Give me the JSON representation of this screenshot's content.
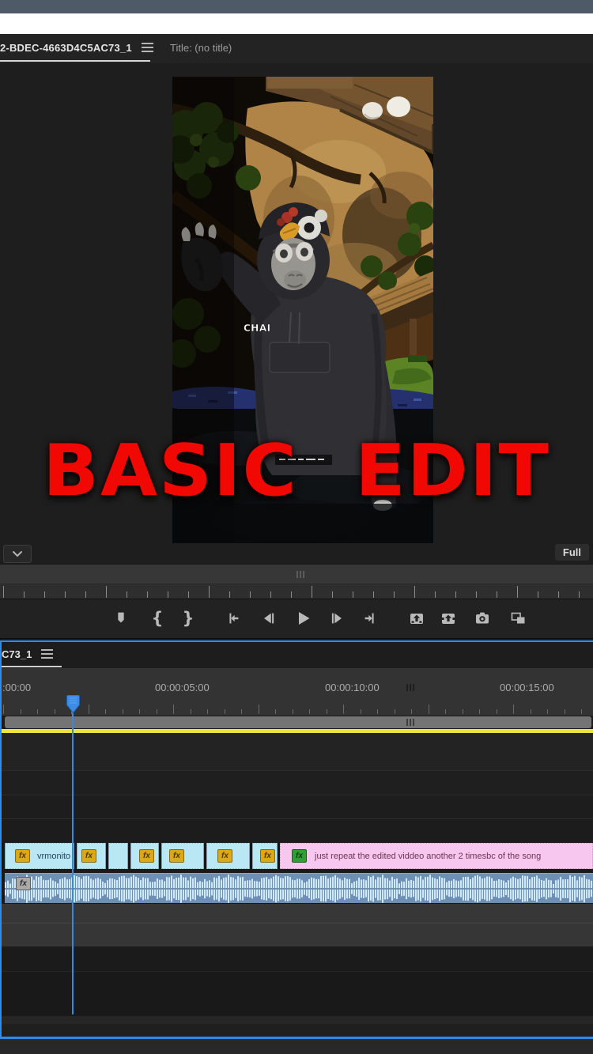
{
  "program_monitor": {
    "tab_label": "2-BDEC-4663D4C5AC73_1",
    "title_label": "Title: (no title)",
    "overlay_text": "BASIC EDIT",
    "player_name": "CHAI",
    "playback_resolution": "Full",
    "mark_in_glyph": "{",
    "mark_out_glyph": "}",
    "transport_buttons": [
      "add-marker",
      "mark-in",
      "mark-out",
      "go-to-in-point",
      "step-back",
      "play",
      "step-forward",
      "go-to-out-point",
      "lift",
      "extract",
      "export-frame",
      "comparison-view"
    ]
  },
  "timeline": {
    "tab_label": "C73_1",
    "ruler_labels": [
      ":00:00",
      "00:00:05:00",
      "00:00:10:00",
      "00:00:15:00"
    ],
    "fx_badge_label": "fx",
    "video_clips": [
      {
        "label": "vrmonito",
        "fx": "fx"
      },
      {
        "fx": "fx"
      },
      {},
      {
        "fx": "fx"
      },
      {
        "fx": "fx"
      },
      {
        "fx": "fx"
      },
      {
        "fx": "fx"
      }
    ],
    "graphics_clip": {
      "fx": "fx",
      "label": "just repeat the edited viddeo another 2 timesbc of the song"
    },
    "audio_clip": {
      "fx": "fx"
    }
  },
  "colors": {
    "panel_focus_blue": "#2d8ceb",
    "render_bar_yellow": "#e9e73c",
    "video_clip_cyan": "#b9e7f4",
    "graphics_clip_pink": "#f8c7f0",
    "audio_clip_blue": "#6d90b4",
    "overlay_red": "#f20803",
    "fx_badge_yellow": "#dca816",
    "fx_badge_green": "#2e9e37",
    "status_bar_slate": "#4e5a68"
  }
}
